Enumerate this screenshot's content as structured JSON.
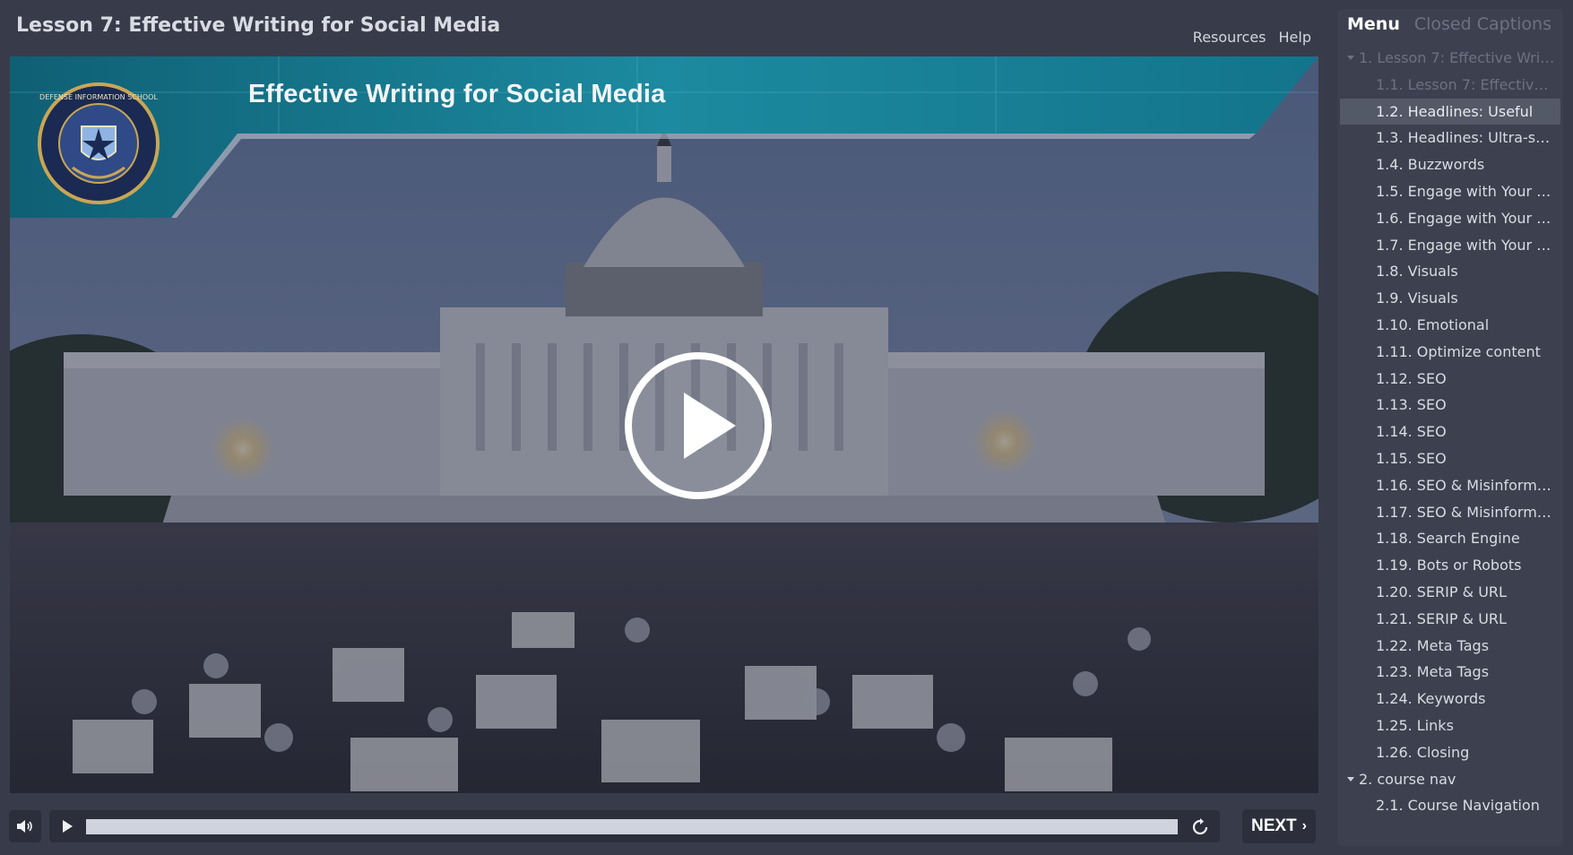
{
  "header": {
    "course_title": "Lesson 7: Effective Writing for Social Media",
    "links": [
      "Resources",
      "Help"
    ]
  },
  "slide": {
    "banner_title": "Effective Writing for Social Media",
    "seal_text": "DEFENSE INFORMATION SCHOOL"
  },
  "player": {
    "next_label": "NEXT",
    "progress": 1.0
  },
  "sidebar": {
    "tabs": [
      {
        "label": "Menu",
        "active": true
      },
      {
        "label": "Closed Captions",
        "active": false
      }
    ],
    "items": [
      {
        "label": "1. Lesson 7: Effective Writi...",
        "level": 1,
        "dim": true
      },
      {
        "label": "1.1. Lesson 7: Effective ...",
        "level": 2,
        "dim": true
      },
      {
        "label": "1.2. Headlines: Useful",
        "level": 2,
        "selected": true
      },
      {
        "label": "1.3. Headlines: Ultra-spe...",
        "level": 2
      },
      {
        "label": "1.4. Buzzwords",
        "level": 2
      },
      {
        "label": "1.5. Engage with Your Au...",
        "level": 2
      },
      {
        "label": "1.6. Engage with Your Au...",
        "level": 2
      },
      {
        "label": "1.7. Engage with Your Au...",
        "level": 2
      },
      {
        "label": "1.8. Visuals",
        "level": 2
      },
      {
        "label": "1.9. Visuals",
        "level": 2
      },
      {
        "label": "1.10. Emotional",
        "level": 2
      },
      {
        "label": "1.11. Optimize content",
        "level": 2
      },
      {
        "label": "1.12. SEO",
        "level": 2
      },
      {
        "label": "1.13. SEO",
        "level": 2
      },
      {
        "label": "1.14. SEO",
        "level": 2
      },
      {
        "label": "1.15. SEO",
        "level": 2
      },
      {
        "label": "1.16. SEO & Misinformat...",
        "level": 2
      },
      {
        "label": "1.17. SEO & Misinformat...",
        "level": 2
      },
      {
        "label": "1.18. Search Engine",
        "level": 2
      },
      {
        "label": "1.19. Bots or Robots",
        "level": 2
      },
      {
        "label": "1.20. SERIP & URL",
        "level": 2
      },
      {
        "label": "1.21. SERIP & URL",
        "level": 2
      },
      {
        "label": "1.22. Meta Tags",
        "level": 2
      },
      {
        "label": "1.23. Meta Tags",
        "level": 2
      },
      {
        "label": "1.24. Keywords",
        "level": 2
      },
      {
        "label": "1.25. Links",
        "level": 2
      },
      {
        "label": "1.26. Closing",
        "level": 2
      },
      {
        "label": "2. course nav",
        "level": 1
      },
      {
        "label": "2.1. Course Navigation",
        "level": 2
      }
    ]
  },
  "colors": {
    "background": "#383c4a",
    "sidebar": "#3d414f",
    "selected_item": "#545968",
    "banner_teal": "#1c8aa0"
  }
}
